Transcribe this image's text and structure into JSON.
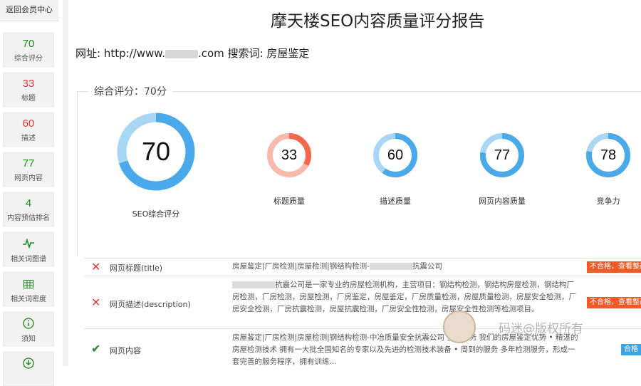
{
  "sidebar": {
    "back_label": "返回会员中心",
    "items": [
      {
        "value": "70",
        "label": "综合评分",
        "color": "#1a8c1a"
      },
      {
        "value": "33",
        "label": "标题",
        "color": "#e53935"
      },
      {
        "value": "60",
        "label": "描述",
        "color": "#e53935"
      },
      {
        "value": "77",
        "label": "网页内容",
        "color": "#1a8c1a"
      },
      {
        "value": "4",
        "label": "内容预估排名",
        "color": "#1a8c1a"
      },
      {
        "icon": "pulse-icon",
        "label": "相关词图谱"
      },
      {
        "icon": "grid-icon",
        "label": "相关词密度"
      },
      {
        "icon": "info-icon",
        "label": "须知"
      },
      {
        "icon": "download-icon",
        "label": ""
      }
    ]
  },
  "header": {
    "title": "摩天楼SEO内容质量评分报告",
    "url_prefix": "网址: http://www.",
    "url_suffix": ".com",
    "keyword_label": "搜索词: 房屋鉴定"
  },
  "score_section": {
    "legend": "综合评分：70分",
    "main": {
      "value": 70,
      "label": "SEO综合评分"
    },
    "subs": [
      {
        "value": 33,
        "label": "标题质量",
        "color": "#f4694b",
        "track": "#f9b9ab"
      },
      {
        "value": 60,
        "label": "描述质量",
        "color": "#49a9ea",
        "track": "#a8d6f5"
      },
      {
        "value": 77,
        "label": "网页内容质量",
        "color": "#49a9ea",
        "track": "#a8d6f5"
      },
      {
        "value": 78,
        "label": "竞争力",
        "color": "#49a9ea",
        "track": "#a8d6f5"
      }
    ],
    "ring_color": "#49a9ea",
    "ring_track": "#a8d6f5"
  },
  "table": {
    "rows": [
      {
        "status": "fail",
        "name": "网页标题(title)",
        "desc_a": "房屋鉴定|厂房检测|房屋检测|钢结构检测-",
        "desc_b": "抗震公司",
        "badge": "不合格，查看整改"
      },
      {
        "status": "fail",
        "name": "网页描述(description)",
        "desc_b": "抗震公司是一家专业的房屋检测机构，主营项目：钢结构检测，钢结构房屋检测，钢结构厂房检测，厂房检测，房屋检测，厂房鉴定，房屋鉴定，厂房质量检测，房屋质量检测，房屋安全检测，厂房安全检测，厂房抗震检测，房屋抗震检测，厂房安全性检测，房屋安全性检测等检测项目。",
        "badge": "不合格，查看整改"
      },
      {
        "status": "pass",
        "name": "网页内容",
        "desc_a": "房屋鉴定|厂房检测|房屋检测|钢结构检测-中冶质量安全抗震公司 主营业务 我们的房屋鉴定优势 • 精湛的房屋检测技术 拥有一大批全国知名的专家以及先进的检测技术装备 • 周到的服务 多年检测服务，形成一套完善的服务程序，拥有训练...",
        "badge": "合格"
      }
    ],
    "fail_color": "#e53935",
    "pass_color": "#2e7d32"
  },
  "watermark": "码迷@版权所有"
}
